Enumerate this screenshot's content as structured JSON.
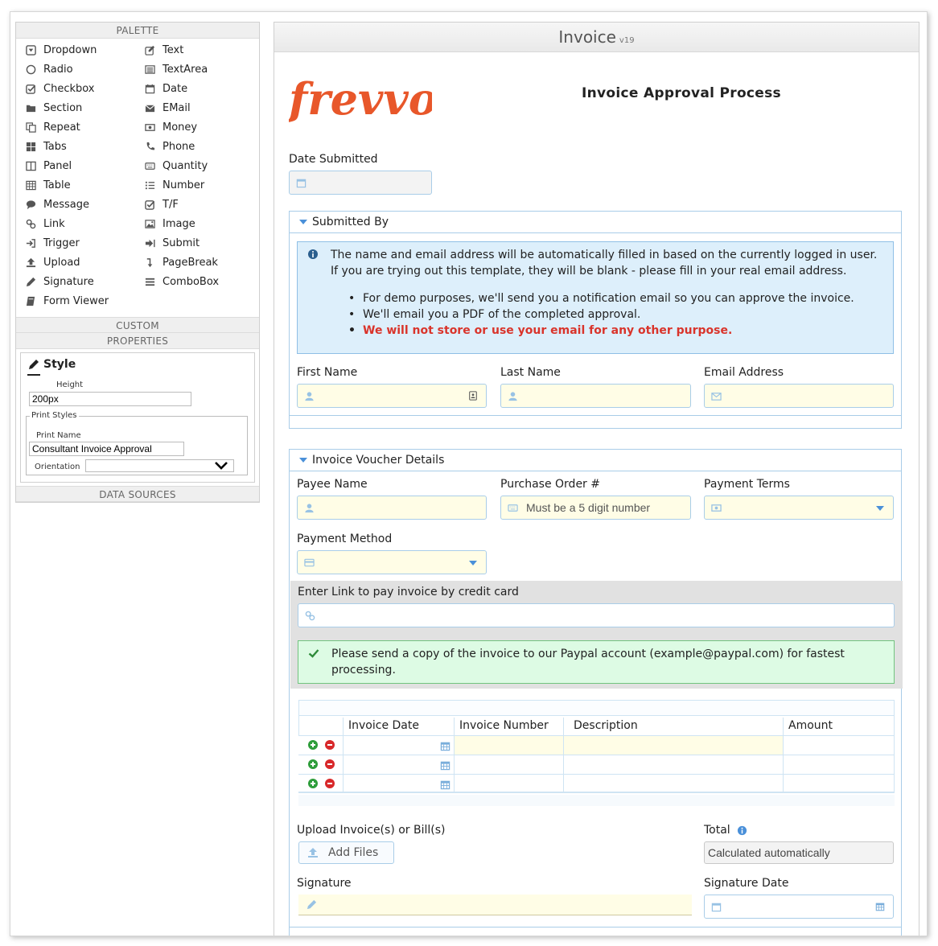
{
  "left_panel": {
    "palette_header": "PALETTE",
    "custom_header": "CUSTOM",
    "properties_header": "PROPERTIES",
    "data_sources_header": "DATA SOURCES",
    "palette_col1": [
      {
        "label": "Dropdown",
        "icon": "dropdown-icon"
      },
      {
        "label": "Radio",
        "icon": "radio-icon"
      },
      {
        "label": "Checkbox",
        "icon": "checkbox-icon"
      },
      {
        "label": "Section",
        "icon": "folder-icon"
      },
      {
        "label": "Repeat",
        "icon": "copy-icon"
      },
      {
        "label": "Tabs",
        "icon": "tabs-icon"
      },
      {
        "label": "Panel",
        "icon": "columns-icon"
      },
      {
        "label": "Table",
        "icon": "table-icon"
      },
      {
        "label": "Message",
        "icon": "comment-icon"
      },
      {
        "label": "Link",
        "icon": "link-icon"
      },
      {
        "label": "Trigger",
        "icon": "sign-in-icon"
      },
      {
        "label": "Upload",
        "icon": "upload-icon"
      },
      {
        "label": "Signature",
        "icon": "pencil-icon"
      },
      {
        "label": "Form Viewer",
        "icon": "book-icon"
      }
    ],
    "palette_col2": [
      {
        "label": "Text",
        "icon": "edit-icon"
      },
      {
        "label": "TextArea",
        "icon": "list-alt-icon"
      },
      {
        "label": "Date",
        "icon": "calendar-icon"
      },
      {
        "label": "EMail",
        "icon": "envelope-icon"
      },
      {
        "label": "Money",
        "icon": "money-icon"
      },
      {
        "label": "Phone",
        "icon": "phone-icon"
      },
      {
        "label": "Quantity",
        "icon": "keyboard-icon"
      },
      {
        "label": "Number",
        "icon": "list-ol-icon"
      },
      {
        "label": "T/F",
        "icon": "check-square-icon"
      },
      {
        "label": "Image",
        "icon": "image-icon"
      },
      {
        "label": "Submit",
        "icon": "submit-arrow-icon"
      },
      {
        "label": "PageBreak",
        "icon": "level-down-icon"
      },
      {
        "label": "ComboBox",
        "icon": "list-icon"
      }
    ],
    "properties": {
      "style_title": "Style",
      "height_label": "Height",
      "height_value": "200px",
      "print_styles_legend": "Print Styles",
      "print_name_label": "Print Name",
      "print_name_value": "Consultant Invoice Approval",
      "orientation_label": "Orientation",
      "orientation_value": ""
    }
  },
  "form": {
    "header_title": "Invoice",
    "header_version": "v19",
    "logo_text": "frevvo",
    "logo_color": "#e8572a",
    "title": "Invoice Approval Process",
    "date_submitted_label": "Date Submitted",
    "submitted_by": {
      "header": "Submitted By",
      "info_paragraph": "The name and email address will be automatically filled in based on the currently logged in user. If you are trying out this template, they will be blank - please fill in your real email address.",
      "bullets": [
        "For demo purposes, we'll send you a notification email so you can approve the invoice.",
        "We'll email you a PDF of the completed approval."
      ],
      "warning_bullet": "We will not store or use your email for any other purpose.",
      "first_name_label": "First Name",
      "last_name_label": "Last Name",
      "email_label": "Email Address"
    },
    "voucher": {
      "header": "Invoice Voucher Details",
      "payee_label": "Payee Name",
      "po_label": "Purchase Order #",
      "po_placeholder": "Must be a 5 digit number",
      "terms_label": "Payment Terms",
      "method_label": "Payment Method",
      "link_label": "Enter Link to pay invoice by credit card",
      "success_message": "Please send a copy of the invoice to our Paypal account (example@paypal.com) for fastest processing.",
      "table_headers": [
        "Invoice Date",
        "Invoice Number",
        "Description",
        "Amount"
      ],
      "upload_label": "Upload Invoice(s) or Bill(s)",
      "add_files_label": "Add Files",
      "total_label": "Total",
      "total_placeholder": "Calculated automatically",
      "signature_label": "Signature",
      "signature_date_label": "Signature Date"
    }
  },
  "colors": {
    "field_border": "#a9cde8",
    "required_bg": "#fffde6",
    "info_bg": "#ddeffb",
    "success_bg": "#ddfbe4",
    "warning_text": "#d9342b"
  }
}
